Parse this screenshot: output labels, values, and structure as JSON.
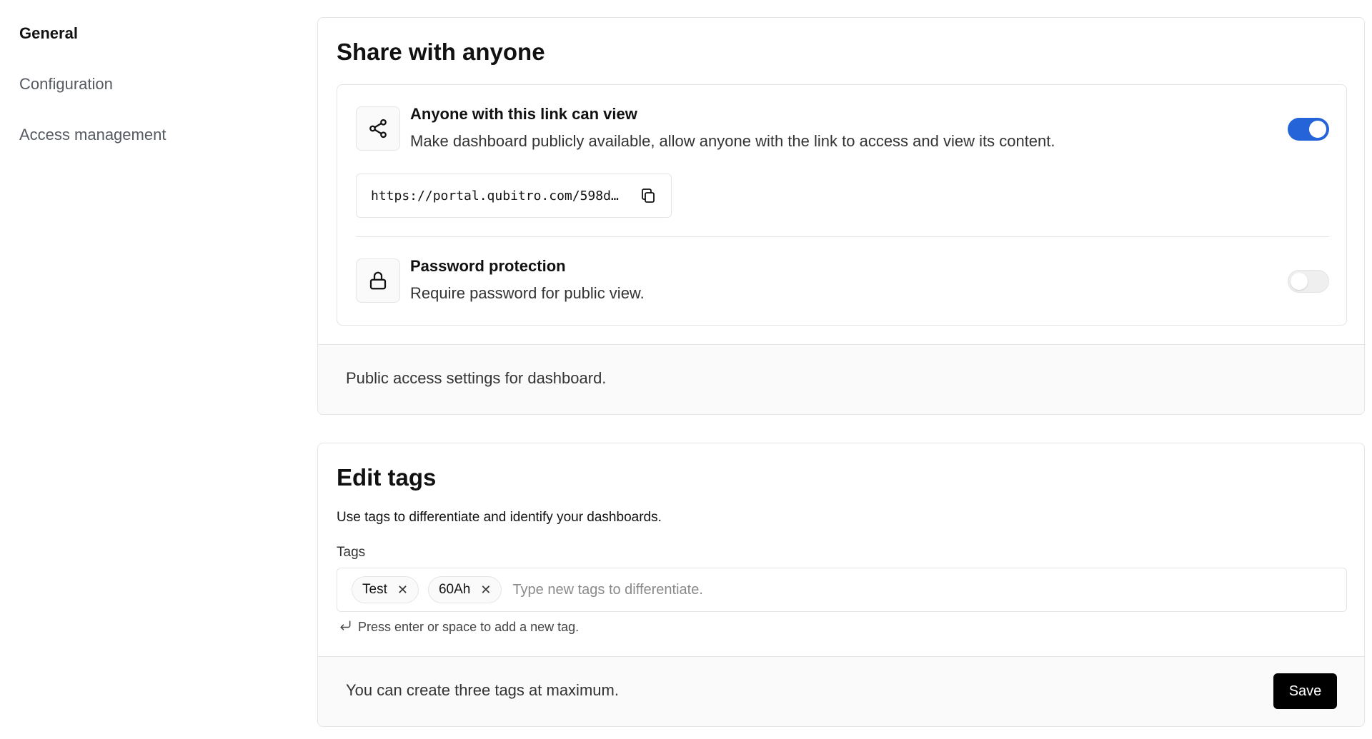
{
  "sidebar": {
    "items": [
      {
        "label": "General",
        "active": true
      },
      {
        "label": "Configuration",
        "active": false
      },
      {
        "label": "Access management",
        "active": false
      }
    ]
  },
  "share": {
    "title": "Share with anyone",
    "link_row": {
      "icon": "share-icon",
      "title": "Anyone with this link can view",
      "description": "Make dashboard publicly available, allow anyone with the link to access and view its content.",
      "enabled": true
    },
    "link_url": "https://portal.qubitro.com/598d…",
    "copy_icon": "copy-icon",
    "password_row": {
      "icon": "lock-icon",
      "title": "Password protection",
      "description": "Require password for public view.",
      "enabled": false
    },
    "footer": "Public access settings for dashboard."
  },
  "tags": {
    "title": "Edit tags",
    "subtitle": "Use tags to differentiate and identify your dashboards.",
    "field_label": "Tags",
    "chips": [
      "Test",
      "60Ah"
    ],
    "placeholder": "Type new tags to differentiate.",
    "hint": "Press enter or space to add a new tag.",
    "footer": "You can create three tags at maximum.",
    "save_label": "Save"
  },
  "colors": {
    "accent": "#2563d9",
    "border": "#e5e5e5",
    "footer_bg": "#fafafa",
    "button_bg": "#000000"
  }
}
